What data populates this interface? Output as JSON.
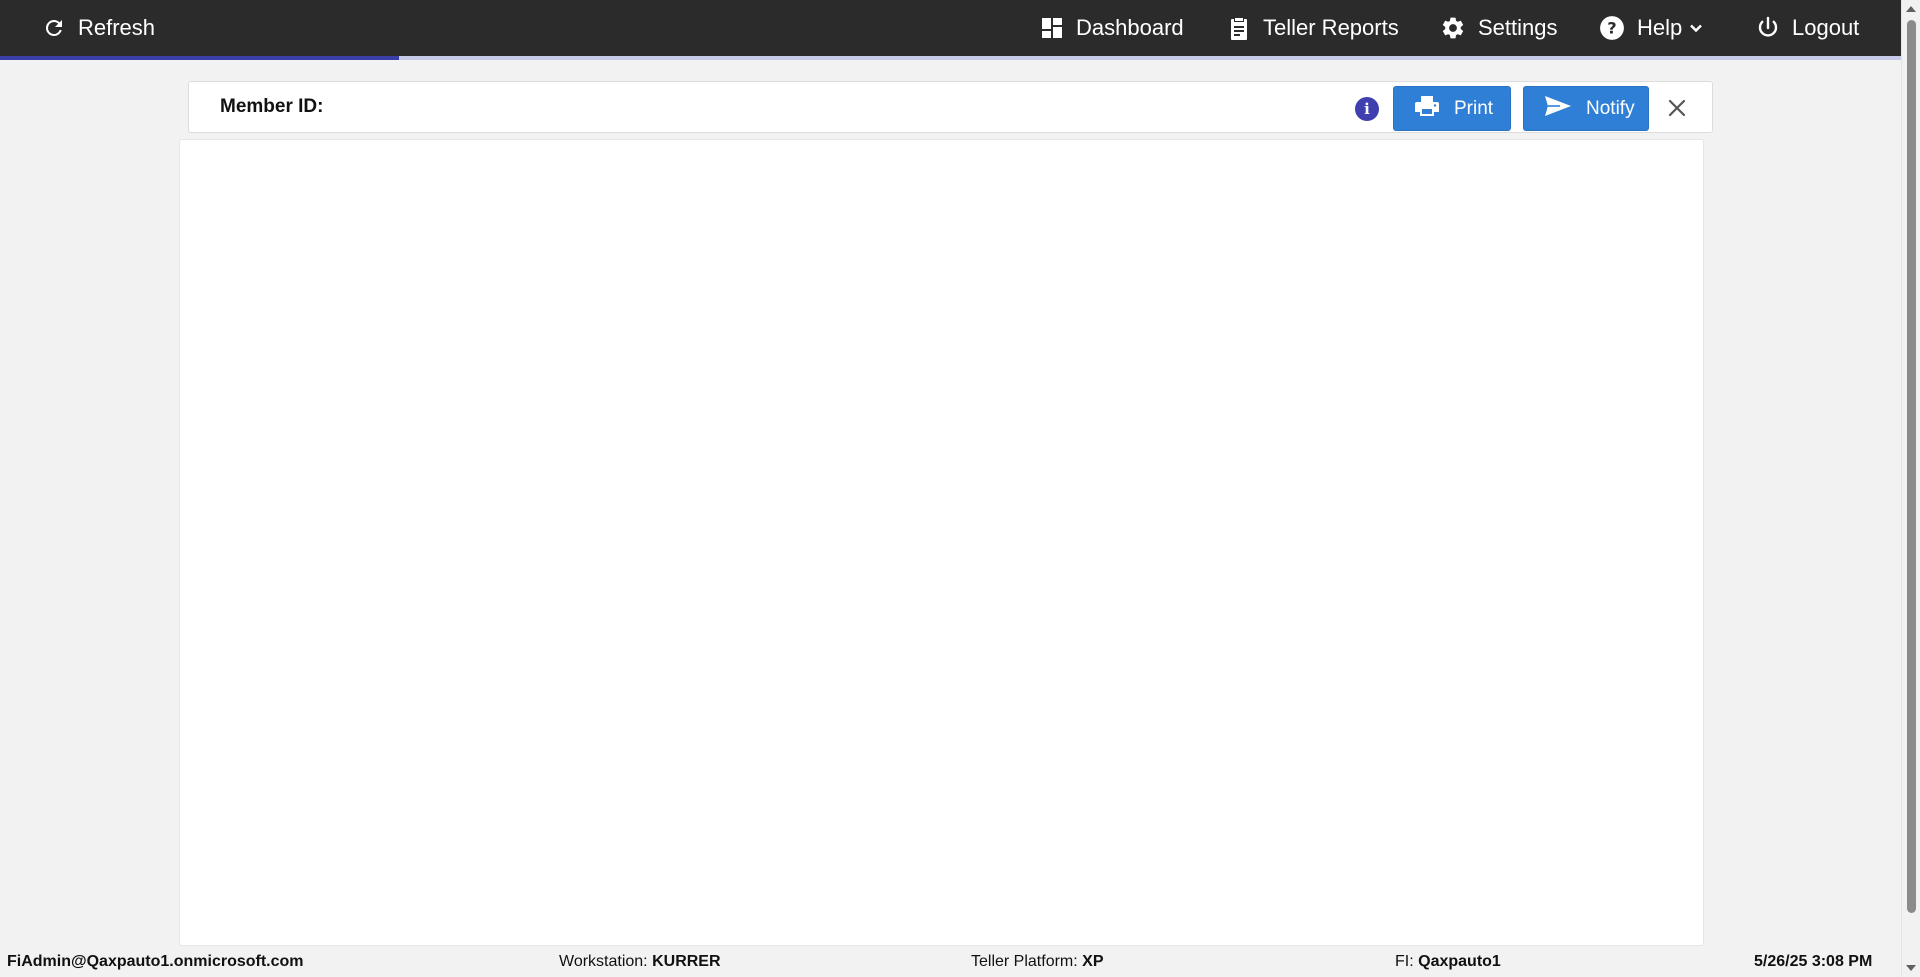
{
  "topbar": {
    "refresh_label": "Refresh",
    "dashboard_label": "Dashboard",
    "teller_reports_label": "Teller Reports",
    "settings_label": "Settings",
    "help_label": "Help",
    "logout_label": "Logout",
    "loading_progress": 0.21
  },
  "member_bar": {
    "member_id_label": "Member ID:",
    "info_icon_glyph": "i",
    "print_label": "Print",
    "notify_label": "Notify"
  },
  "footer": {
    "user": "FiAdmin@Qaxpauto1.onmicrosoft.com",
    "workstation_label": "Workstation:",
    "workstation_value": "KURRER",
    "platform_label": "Teller Platform:",
    "platform_value": "XP",
    "fi_label": "FI:",
    "fi_value": "Qaxpauto1",
    "datetime": "5/26/25 3:08 PM"
  },
  "icons": {
    "refresh": "refresh-icon",
    "dashboard": "dashboard-icon",
    "teller_reports": "clipboard-icon",
    "settings": "gear-icon",
    "help": "question-circle-icon",
    "help_dropdown": "chevron-down-icon",
    "logout": "power-icon",
    "info": "info-icon",
    "print": "printer-icon",
    "notify": "send-icon",
    "close": "close-icon"
  },
  "colors": {
    "topbar_bg": "#2b2b2b",
    "accent_blue": "#2f7fd6",
    "progress_fill": "#3b3fa8",
    "info_icon": "#3f3fb0",
    "page_bg": "#f2f2f2"
  }
}
